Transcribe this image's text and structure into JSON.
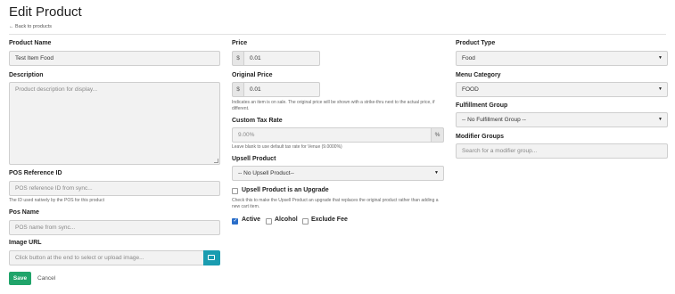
{
  "page": {
    "title": "Edit Product",
    "back_link": "← Back to products"
  },
  "left": {
    "product_name_label": "Product Name",
    "product_name_value": "Test Item Food",
    "description_label": "Description",
    "description_placeholder": "Product description for display...",
    "pos_ref_label": "POS Reference ID",
    "pos_ref_placeholder": "POS reference ID from sync...",
    "pos_ref_help": "The ID used natively by the POS for this product",
    "pos_name_label": "Pos Name",
    "pos_name_placeholder": "POS name from sync...",
    "image_url_label": "Image URL",
    "image_url_placeholder": "Click button at the end to select or upload image..."
  },
  "middle": {
    "price_label": "Price",
    "price_addon": "$",
    "price_value": "0.01",
    "original_price_label": "Original Price",
    "original_price_addon": "$",
    "original_price_value": "0.01",
    "original_price_help": "Indicates an item is on sale. The original price will be shown with a strike-thru next to the actual price, if different.",
    "custom_tax_label": "Custom Tax Rate",
    "custom_tax_placeholder": "9.00%",
    "custom_tax_addon": "%",
    "custom_tax_help": "Leave blank to use default tax rate for Venue (9.0000%)",
    "upsell_label": "Upsell Product",
    "upsell_value": "-- No Upsell Product--",
    "upsell_upgrade_label": "Upsell Product is an Upgrade",
    "upsell_upgrade_help": "Check this to make the Upsell Product an upgrade that replaces the original product rather than adding a new cart item.",
    "active_label": "Active",
    "active_checked": true,
    "alcohol_label": "Alcohol",
    "alcohol_checked": false,
    "exclude_fee_label": "Exclude Fee",
    "exclude_fee_checked": false
  },
  "right": {
    "product_type_label": "Product Type",
    "product_type_value": "Food",
    "menu_category_label": "Menu Category",
    "menu_category_value": "FOOD",
    "fulfillment_label": "Fulfillment Group",
    "fulfillment_value": "-- No Fulfillment Group --",
    "modifier_label": "Modifier Groups",
    "modifier_placeholder": "Search for a modifier group..."
  },
  "actions": {
    "save_label": "Save",
    "cancel_label": "Cancel"
  },
  "colors": {
    "save": "#20a46a",
    "image_button": "#1a9cb0",
    "checkbox_on": "#2a6ec9"
  }
}
